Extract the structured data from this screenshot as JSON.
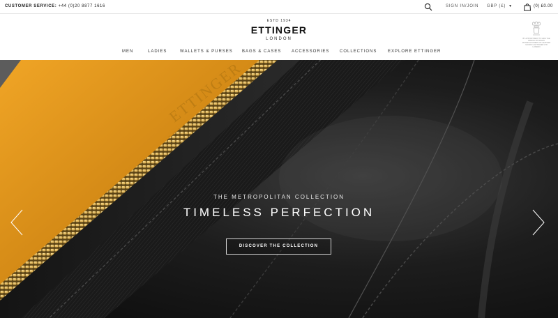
{
  "topbar": {
    "customer_service_label": "CUSTOMER SERVICE:",
    "customer_service_phone": "+44 (0)20 8877 1616",
    "sign_in": "SIGN IN/JOIN",
    "currency": "GBP (£)",
    "bag_summary": "(0) £0.00",
    "icons": [
      "search-icon",
      "chevron-down-icon",
      "shopping-bag-icon"
    ]
  },
  "header": {
    "estd": "ESTD 1934",
    "brand": "ETTINGER",
    "city": "LONDON",
    "warrant_text": "BY APPOINTMENT TO HRH THE PRINCE OF WALES MANUFACTURERS OF LEATHER GOODS G ETTINGER LTD LONDON"
  },
  "nav": {
    "items": [
      {
        "label": "MEN"
      },
      {
        "label": "LADIES"
      },
      {
        "label": "WALLETS & PURSES"
      },
      {
        "label": "BAGS & CASES"
      },
      {
        "label": "ACCESSORIES"
      },
      {
        "label": "COLLECTIONS"
      },
      {
        "label": "EXPLORE ETTINGER"
      }
    ]
  },
  "hero": {
    "subtitle": "THE METROPOLITAN COLLECTION",
    "headline": "TIMELESS PERFECTION",
    "cta": "DISCOVER THE COLLECTION",
    "colors": {
      "leather_tan": "#d8921c",
      "leather_dark": "#1a1a1a",
      "zip_gold": "#c9a24a"
    },
    "icons": [
      "chevron-left-icon",
      "chevron-right-icon"
    ]
  }
}
